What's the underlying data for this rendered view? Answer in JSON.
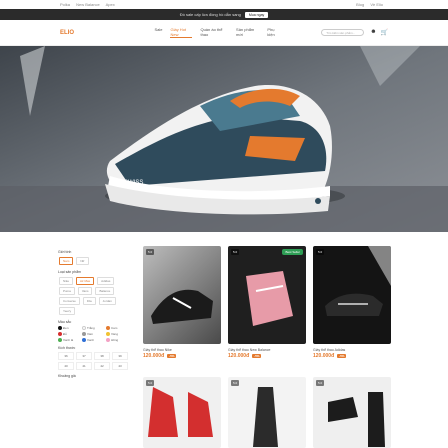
{
  "topbar": {
    "left": [
      "Polka",
      "New Balance",
      "Apex"
    ],
    "right": [
      "Blog",
      "Về Elio"
    ]
  },
  "promo": {
    "text": "Đồ sale cấp lừa đồng hồ dẫn sang",
    "button": "Mua ngay"
  },
  "header": {
    "logo": "ELIO",
    "nav": [
      "Sale",
      "Giày Hot New",
      "Quần áo thể thao",
      "Sản phẩm mới",
      "Phụ kiện"
    ],
    "active_nav": "Giày Hot New",
    "search_placeholder": "Tìm kiếm sản phẩm..."
  },
  "filters": {
    "gender_title": "Giới tính",
    "gender": [
      "Nam",
      "Nữ"
    ],
    "type_title": "Loại sản phẩm",
    "types": [
      "Nike",
      "Air Max",
      "Adidas",
      "Puma",
      "Vans",
      "Balance",
      "Converse",
      "Fila",
      "Jordan",
      "Yeezy"
    ],
    "color_title": "Màu sắc",
    "colors": [
      {
        "name": "Đen",
        "hex": "#111111"
      },
      {
        "name": "Trắng",
        "hex": "#ffffff"
      },
      {
        "name": "Cam",
        "hex": "#e47a2e"
      },
      {
        "name": "Đỏ",
        "hex": "#d62f2f"
      },
      {
        "name": "Xám",
        "hex": "#999999"
      },
      {
        "name": "Vàng",
        "hex": "#f1c232"
      },
      {
        "name": "Xanh lá",
        "hex": "#4caf50"
      },
      {
        "name": "Xanh",
        "hex": "#2f6fd6"
      },
      {
        "name": "Hồng",
        "hex": "#f3a1c4"
      }
    ],
    "size_title": "Kích thước",
    "sizes": [
      "36",
      "37",
      "38",
      "39",
      "40",
      "41",
      "42",
      "43"
    ],
    "price_title": "Khoảng giá"
  },
  "products": [
    {
      "name": "Giày thể thao Nike",
      "price": "120.000đ",
      "sale": "-5%",
      "badge": "5.0",
      "tag": ""
    },
    {
      "name": "Giày thể thao New Balance",
      "price": "120.000đ",
      "sale": "-5%",
      "badge": "5.0",
      "tag": "Best Seller"
    },
    {
      "name": "Giày thể thao Adidas",
      "price": "120.000đ",
      "sale": "-5%",
      "badge": "5.0",
      "tag": ""
    },
    {
      "name": "",
      "price": "",
      "sale": "",
      "badge": "5.0",
      "tag": ""
    },
    {
      "name": "",
      "price": "",
      "sale": "",
      "badge": "5.0",
      "tag": ""
    },
    {
      "name": "",
      "price": "",
      "sale": "",
      "badge": "5.0",
      "tag": ""
    }
  ]
}
